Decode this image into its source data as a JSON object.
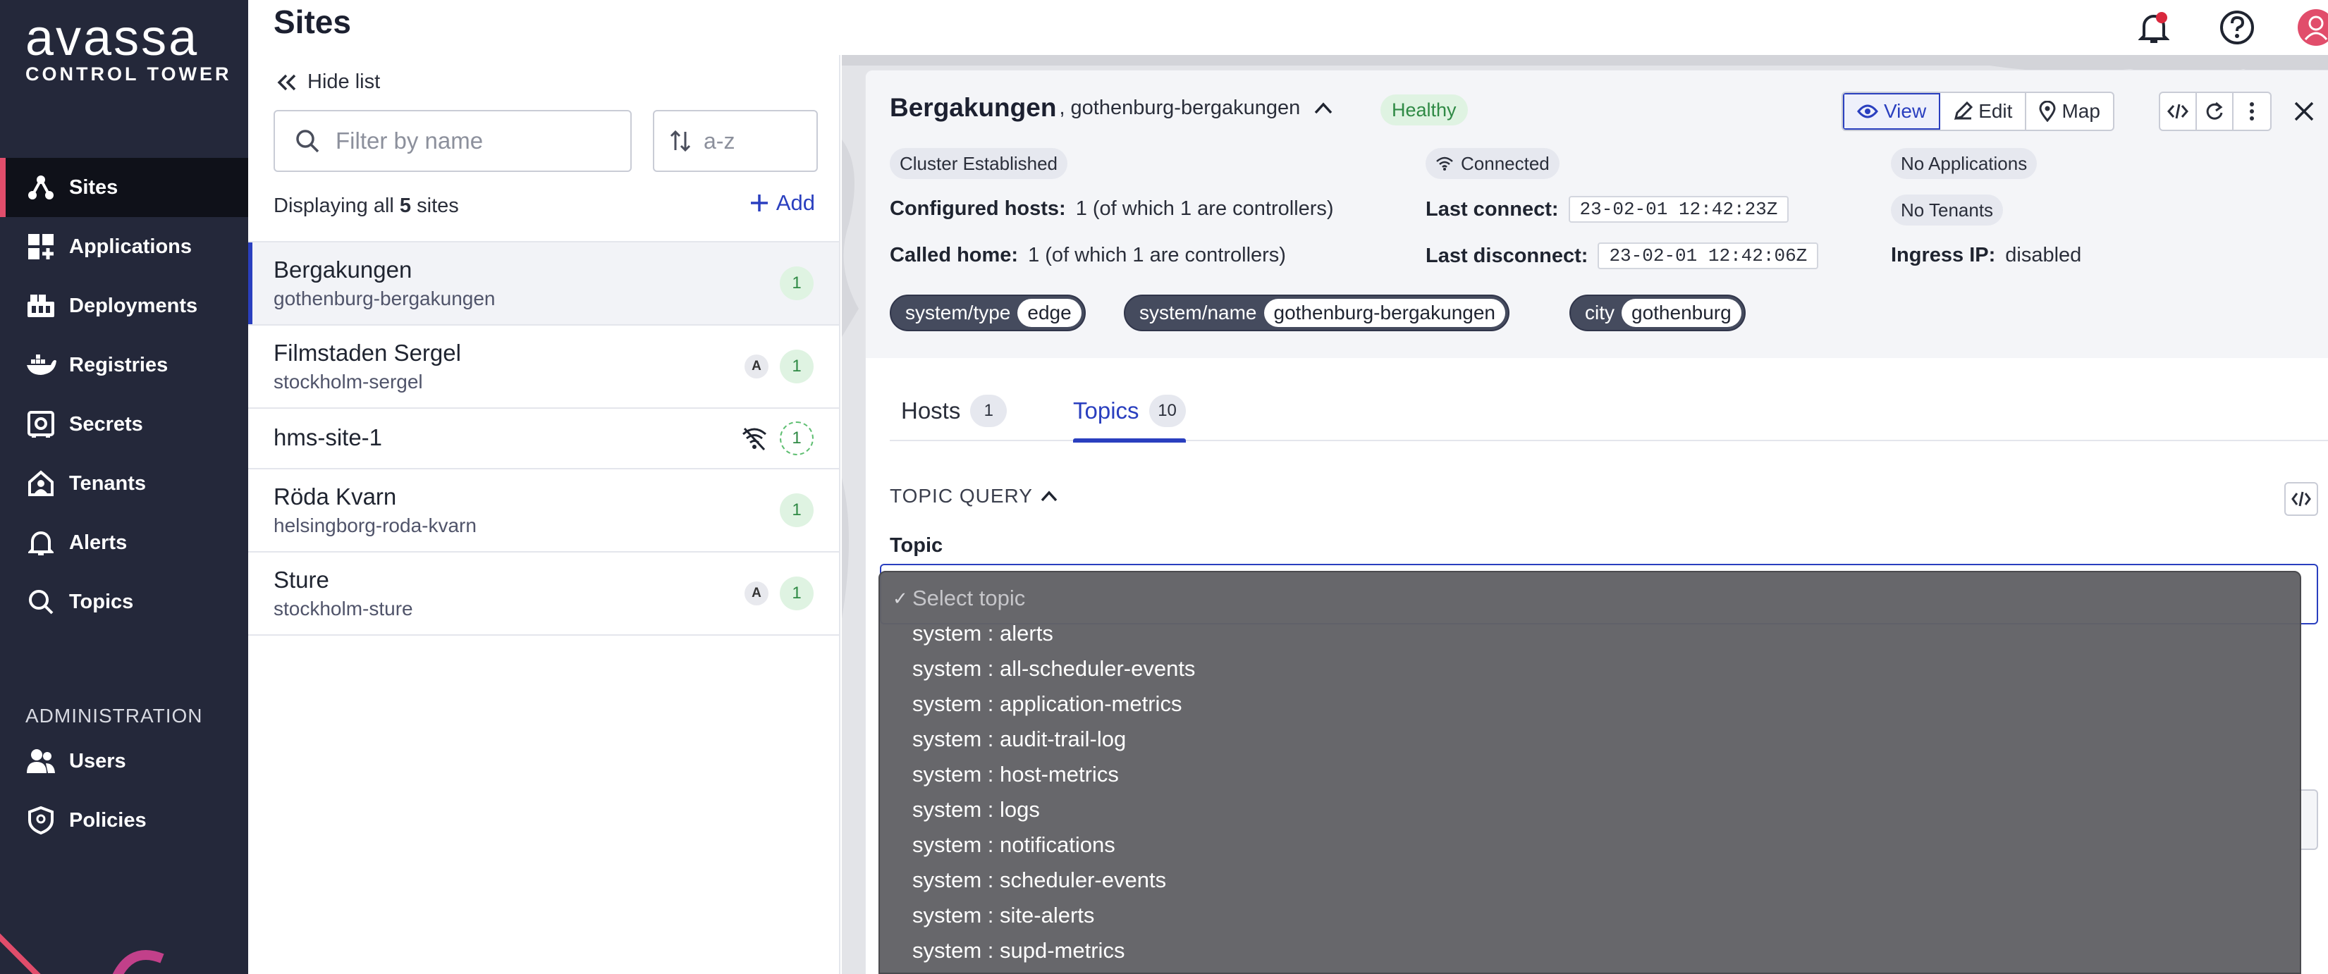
{
  "app": {
    "logo_word": "avassa",
    "logo_sub": "CONTROL TOWER"
  },
  "nav": {
    "items": [
      {
        "label": "Sites",
        "icon": "sites-icon",
        "active": true
      },
      {
        "label": "Applications",
        "icon": "applications-icon"
      },
      {
        "label": "Deployments",
        "icon": "deployments-icon"
      },
      {
        "label": "Registries",
        "icon": "registries-icon"
      },
      {
        "label": "Secrets",
        "icon": "secrets-icon"
      },
      {
        "label": "Tenants",
        "icon": "tenants-icon"
      },
      {
        "label": "Alerts",
        "icon": "bell-icon"
      },
      {
        "label": "Topics",
        "icon": "search-icon"
      }
    ],
    "admin_heading": "ADMINISTRATION",
    "admin_items": [
      {
        "label": "Users",
        "icon": "users-icon"
      },
      {
        "label": "Policies",
        "icon": "policies-icon"
      }
    ]
  },
  "header": {
    "title": "Sites"
  },
  "sitelist": {
    "hide_list_label": "Hide list",
    "filter_placeholder": "Filter by name",
    "sort_label": "a-z",
    "displaying_prefix": "Displaying all",
    "displaying_count": "5",
    "displaying_suffix": "sites",
    "add_label": "Add",
    "sites": [
      {
        "name": "Bergakungen",
        "slug": "gothenburg-bergakungen",
        "count": "1",
        "a_badge": "",
        "selected": true
      },
      {
        "name": "Filmstaden Sergel",
        "slug": "stockholm-sergel",
        "count": "1",
        "a_badge": "A"
      },
      {
        "name": "hms-site-1",
        "slug": "",
        "count": "1",
        "a_badge": "",
        "disconnected": true
      },
      {
        "name": "Röda Kvarn",
        "slug": "helsingborg-roda-kvarn",
        "count": "1",
        "a_badge": ""
      },
      {
        "name": "Sture",
        "slug": "stockholm-sture",
        "count": "1",
        "a_badge": "A"
      }
    ]
  },
  "details": {
    "site_name": "Bergakungen",
    "site_slug": ", gothenburg-bergakungen",
    "health": "Healthy",
    "buttons": {
      "view": "View",
      "edit": "Edit",
      "map": "Map"
    },
    "cluster_status": "Cluster Established",
    "connection_status": "Connected",
    "applications_status": "No Applications",
    "tenants_status": "No Tenants",
    "configured_hosts_label": "Configured hosts:",
    "configured_hosts_value": "1 (of which 1 are controllers)",
    "called_home_label": "Called home:",
    "called_home_value": "1 (of which 1 are controllers)",
    "last_connect_label": "Last connect:",
    "last_connect_value": "23-02-01 12:42:23Z",
    "last_disconnect_label": "Last disconnect:",
    "last_disconnect_value": "23-02-01 12:42:06Z",
    "ingress_label": "Ingress IP:",
    "ingress_value": "disabled",
    "labels": [
      {
        "key": "system/type",
        "value": "edge"
      },
      {
        "key": "system/name",
        "value": "gothenburg-bergakungen"
      },
      {
        "key": "city",
        "value": "gothenburg"
      }
    ],
    "tabs": [
      {
        "label": "Hosts",
        "count": "1"
      },
      {
        "label": "Topics",
        "count": "10",
        "active": true
      }
    ],
    "topic_query_label": "TOPIC QUERY",
    "topic_field_label": "Topic"
  },
  "dropdown": {
    "placeholder": "Select topic",
    "options": [
      "system : alerts",
      "system : all-scheduler-events",
      "system : application-metrics",
      "system : audit-trail-log",
      "system : host-metrics",
      "system : logs",
      "system : notifications",
      "system : scheduler-events",
      "system : site-alerts",
      "system : supd-metrics"
    ]
  },
  "colors": {
    "nav_bg": "#24283a",
    "nav_active_bg": "#0f1119",
    "accent": "#2a3fbf",
    "brand_pink": "#e14d6b",
    "healthy_bg": "#dff3e2",
    "healthy_text": "#2f8a45"
  }
}
